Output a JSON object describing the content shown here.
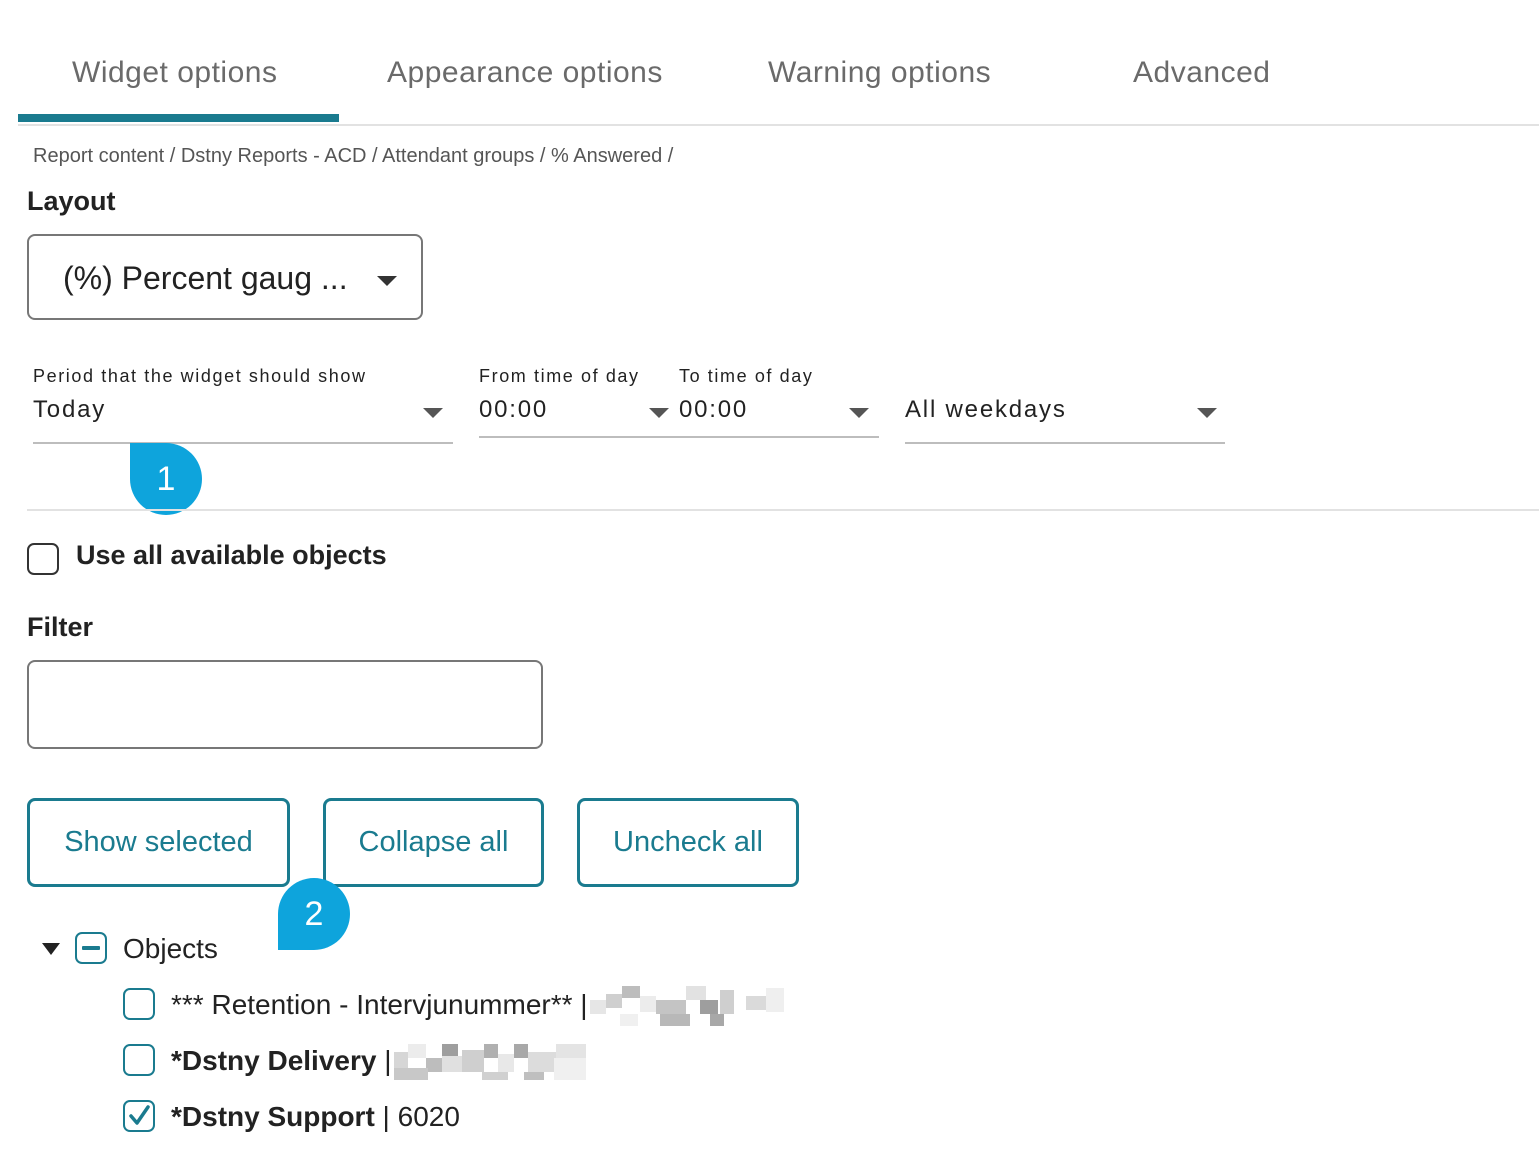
{
  "tabs": [
    {
      "label": "Widget options",
      "active": true
    },
    {
      "label": "Appearance options",
      "active": false
    },
    {
      "label": "Warning options",
      "active": false
    },
    {
      "label": "Advanced",
      "active": false
    }
  ],
  "breadcrumb": "Report content / Dstny Reports - ACD / Attendant groups / % Answered /",
  "layout": {
    "label": "Layout",
    "selected": "(%) Percent gaug ..."
  },
  "period": {
    "label": "Period that the widget should show",
    "value": "Today"
  },
  "from_time": {
    "label": "From time of day",
    "value": "00:00"
  },
  "to_time": {
    "label": "To time of day",
    "value": "00:00"
  },
  "weekdays": {
    "value": "All weekdays"
  },
  "use_all_objects": {
    "label": "Use all available objects",
    "checked": false
  },
  "filter": {
    "label": "Filter",
    "value": "",
    "placeholder": ""
  },
  "buttons": {
    "show_selected": "Show selected",
    "collapse_all": "Collapse all",
    "uncheck_all": "Uncheck all"
  },
  "callouts": [
    "1",
    "2"
  ],
  "tree": {
    "root_label": "Objects",
    "root_state": "indeterminate",
    "items": [
      {
        "name": "*** Retention - Intervjunummer**",
        "separator": " | ",
        "number": "",
        "checked": false,
        "bold": false,
        "redacted": true
      },
      {
        "name": "*Dstny Delivery",
        "separator": " | ",
        "number": "",
        "checked": false,
        "bold": true,
        "redacted": true
      },
      {
        "name": "*Dstny Support",
        "separator": " | ",
        "number": "6020",
        "checked": true,
        "bold": true,
        "redacted": false
      }
    ]
  },
  "colors": {
    "accent": "#1a7b8f",
    "callout": "#0ea4dc",
    "tab_text": "#6a6a6a"
  },
  "icons": {
    "dropdown": "caret-down-icon",
    "tree_toggle": "caret-down-icon",
    "checkbox_checked": "checkmark-icon",
    "checkbox_indeterminate": "minus-icon"
  }
}
